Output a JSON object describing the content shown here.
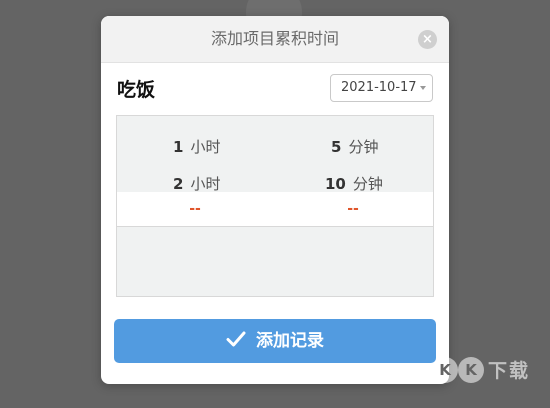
{
  "dialog": {
    "title": "添加项目累积时间",
    "close_symbol": "×",
    "item_name": "吃饭",
    "date": {
      "value": "2021-10-17"
    },
    "values": {
      "left": "--",
      "right": "--"
    },
    "presets": [
      {
        "num": "1",
        "unit": "小时"
      },
      {
        "num": "5",
        "unit": "分钟"
      },
      {
        "num": "2",
        "unit": "小时"
      },
      {
        "num": "10",
        "unit": "分钟"
      }
    ],
    "add_button": {
      "label": "添加记录"
    }
  },
  "watermark": {
    "letters": [
      "K",
      "K"
    ],
    "text": "下载"
  },
  "colors": {
    "overlay": "#646464",
    "accent": "#529be0",
    "value_red": "#e0552b"
  },
  "icons": {
    "close": "close-icon",
    "check": "check-icon",
    "caret": "chevron-down-icon"
  }
}
